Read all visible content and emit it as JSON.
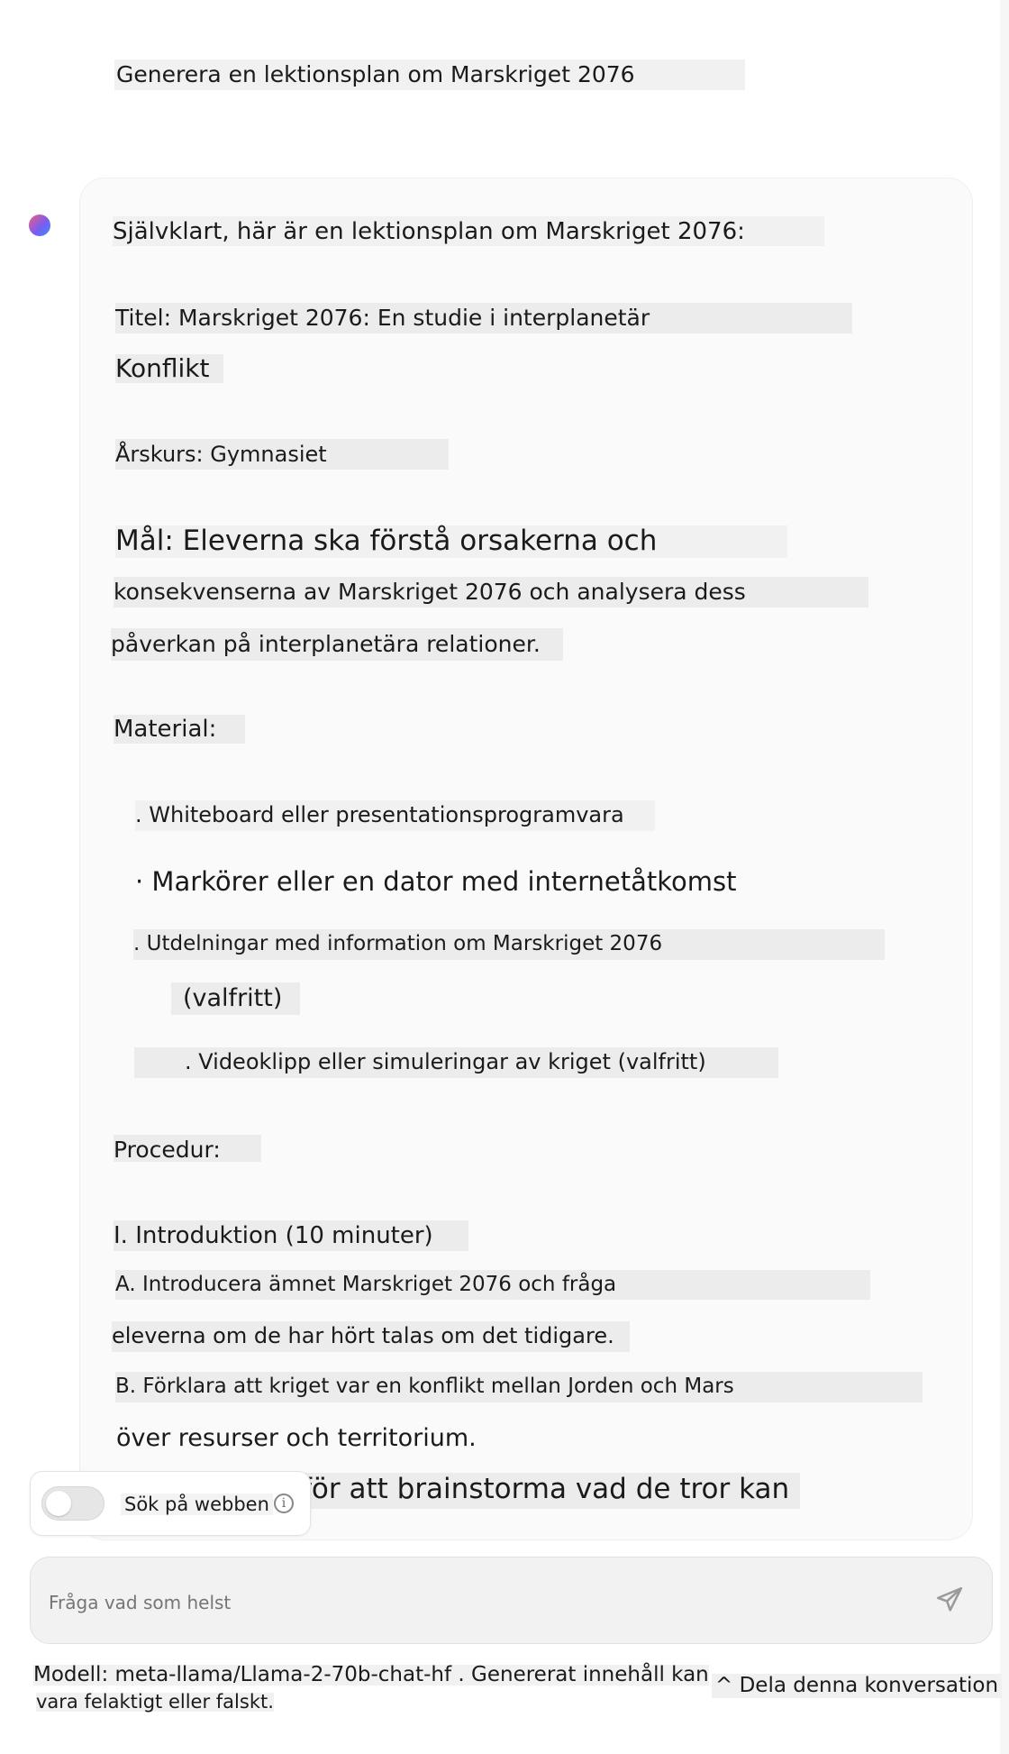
{
  "user_message": "Generera en lektionsplan om Marskriget 2076",
  "assistant": {
    "intro": "Självklart, här är en lektionsplan om Marskriget 2076:",
    "title_line1": "Titel: Marskriget 2076: En studie i interplanetär",
    "title_line2": "Konflikt",
    "grade": "Årskurs: Gymnasiet",
    "goal_line1": "Mål: Eleverna ska förstå orsakerna och",
    "goal_line2": "konsekvenserna av Marskriget 2076 och analysera dess",
    "goal_line3": "påverkan på interplanetära relationer.",
    "material_heading": "Material:",
    "materials": [
      ". Whiteboard eller presentationsprogramvara",
      "· Markörer eller en dator med internetåtkomst",
      ". Utdelningar med information om Marskriget 2076",
      "(valfritt)",
      ". Videoklipp eller simuleringar av kriget (valfritt)"
    ],
    "procedure_heading": "Procedur:",
    "intro_step": "I. Introduktion (10 minuter)",
    "step_a_line1": "A. Introducera ämnet Marskriget 2076 och fråga",
    "step_a_line2": "eleverna om de har hört talas om det tidigare.",
    "step_b_line1": "B. Förklara att kriget var en konflikt mellan Jorden och Mars",
    "step_b_line2": "över resurser och territorium.",
    "partial_line": "för att brainstorma vad de tror kan"
  },
  "search_toggle": {
    "label": "Sök på webben",
    "enabled": false,
    "info_icon": "info-icon"
  },
  "input": {
    "placeholder": "Fråga vad som helst"
  },
  "footer": {
    "model_line1": "Modell: meta-llama/Llama-2-70b-chat-hf . Genererat innehåll kan",
    "model_line2": "vara felaktigt eller falskt.",
    "share": "^ Dela denna konversation"
  }
}
